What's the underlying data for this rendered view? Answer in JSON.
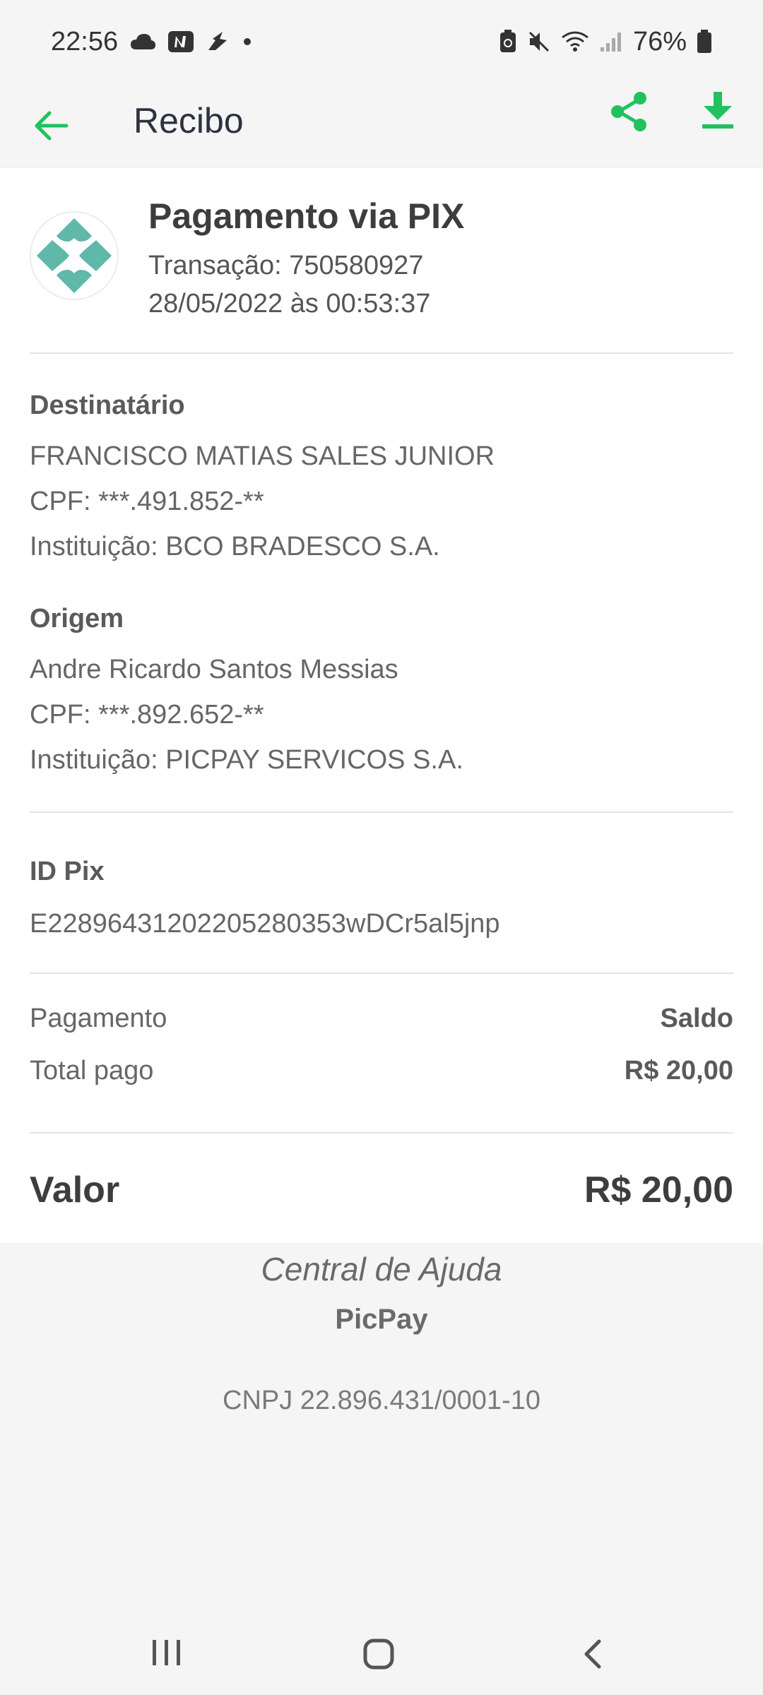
{
  "status_bar": {
    "time": "22:56",
    "battery": "76%"
  },
  "app_bar": {
    "title": "Recibo",
    "icons": [
      "back-arrow-icon",
      "share-icon",
      "download-icon"
    ]
  },
  "transaction": {
    "title": "Pagamento via PIX",
    "transaction_line": "Transação: 750580927",
    "datetime": "28/05/2022 às 00:53:37"
  },
  "recipient": {
    "label": "Destinatário",
    "name": "FRANCISCO MATIAS SALES JUNIOR",
    "cpf": "CPF: ***.491.852-**",
    "institution": "Instituição: BCO BRADESCO S.A."
  },
  "origin": {
    "label": "Origem",
    "name": "Andre Ricardo Santos Messias",
    "cpf": "CPF: ***.892.652-**",
    "institution": "Instituição: PICPAY SERVICOS S.A."
  },
  "pix": {
    "label": "ID Pix",
    "id": "E22896431202205280353wDCr5al5jnp"
  },
  "payment": {
    "method_label": "Pagamento",
    "method_value": "Saldo",
    "total_label": "Total pago",
    "total_value": "R$ 20,00"
  },
  "valor": {
    "label": "Valor",
    "value": "R$ 20,00"
  },
  "footer": {
    "help_link": "Central de Ajuda",
    "brand": "PicPay",
    "cnpj": "CNPJ 22.896.431/0001-10"
  },
  "colors": {
    "accent": "#21c25e",
    "pix": "#5fb8a9"
  }
}
